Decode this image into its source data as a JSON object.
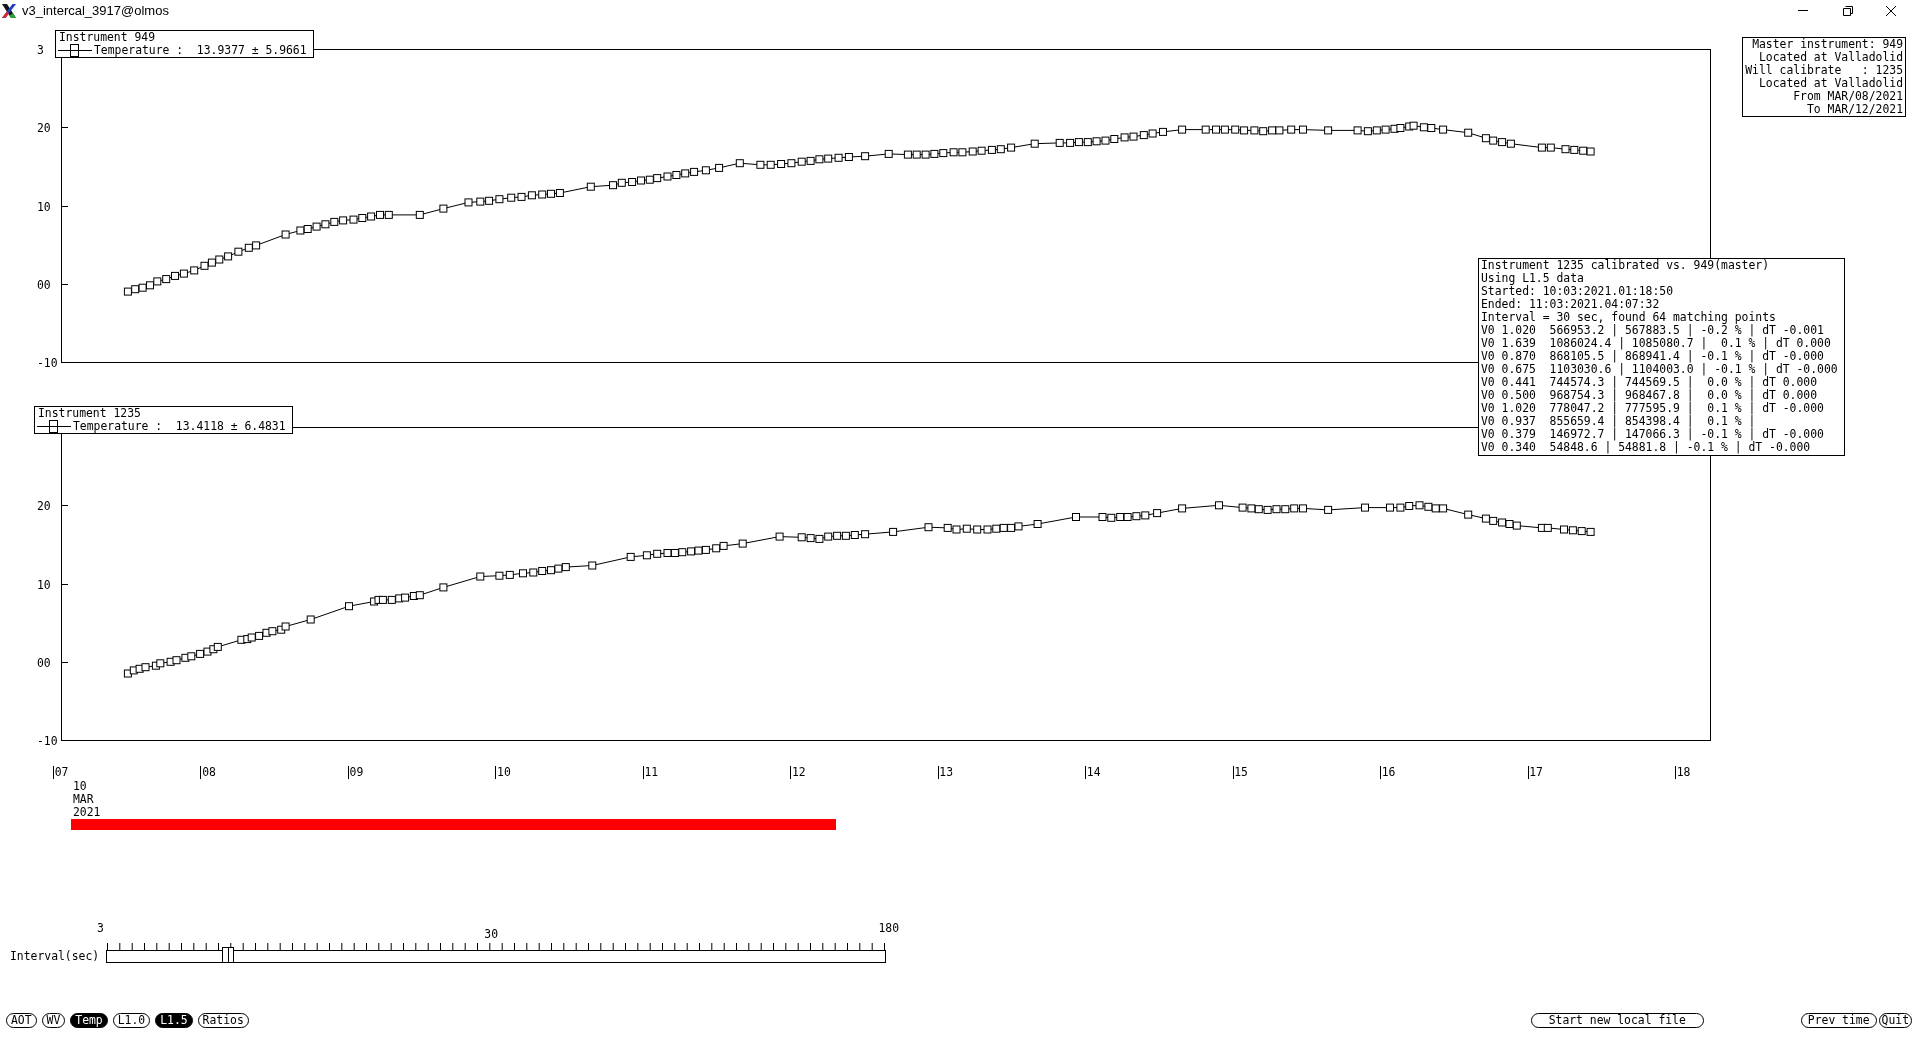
{
  "window": {
    "title": "v3_intercal_3917@olmos"
  },
  "charts": [
    {
      "partial_tick_label": "3",
      "chart_data": {
        "type": "line",
        "title": "Instrument 949",
        "xlim": [
          7.0,
          18.18
        ],
        "ylim": [
          -10,
          30
        ],
        "yticks": [
          {
            "value": 20,
            "label": "20"
          },
          {
            "value": 10,
            "label": "10"
          },
          {
            "value": 0,
            "label": "00"
          },
          {
            "value": -10,
            "label": "-10"
          }
        ],
        "x": [
          7.45,
          7.5,
          7.55,
          7.6,
          7.65,
          7.71,
          7.77,
          7.83,
          7.9,
          7.97,
          8.02,
          8.07,
          8.13,
          8.2,
          8.27,
          8.32,
          8.52,
          8.62,
          8.67,
          8.73,
          8.79,
          8.85,
          8.91,
          8.98,
          9.04,
          9.1,
          9.16,
          9.22,
          9.43,
          9.59,
          9.76,
          9.84,
          9.9,
          9.97,
          10.05,
          10.12,
          10.19,
          10.26,
          10.32,
          10.38,
          10.59,
          10.74,
          10.8,
          10.87,
          10.93,
          10.99,
          11.04,
          11.11,
          11.17,
          11.23,
          11.29,
          11.37,
          11.46,
          11.6,
          11.74,
          11.81,
          11.88,
          11.95,
          12.02,
          12.08,
          12.14,
          12.2,
          12.27,
          12.34,
          12.45,
          12.61,
          12.74,
          12.8,
          12.86,
          12.92,
          12.98,
          13.05,
          13.11,
          13.18,
          13.24,
          13.31,
          13.37,
          13.44,
          13.6,
          13.77,
          13.84,
          13.9,
          13.96,
          14.02,
          14.08,
          14.14,
          14.21,
          14.27,
          14.34,
          14.4,
          14.47,
          14.6,
          14.76,
          14.83,
          14.89,
          14.96,
          15.02,
          15.09,
          15.15,
          15.21,
          15.26,
          15.34,
          15.42,
          15.59,
          15.79,
          15.86,
          15.92,
          15.98,
          16.04,
          16.08,
          16.14,
          16.17,
          16.24,
          16.29,
          16.37,
          16.54,
          16.66,
          16.71,
          16.77,
          16.83,
          17.04,
          17.1,
          17.2,
          17.26,
          17.32,
          17.37
        ],
        "series": [
          {
            "name": "Temperature :  13.9377 ± 5.9661",
            "color": "#000000",
            "marker": "square",
            "values": [
              -1.0,
              -0.7,
              -0.5,
              -0.2,
              0.3,
              0.6,
              1.0,
              1.3,
              1.7,
              2.3,
              2.7,
              3.1,
              3.5,
              4.1,
              4.6,
              4.9,
              6.3,
              6.8,
              7.0,
              7.3,
              7.6,
              7.9,
              8.1,
              8.2,
              8.4,
              8.6,
              8.8,
              8.8,
              8.8,
              9.6,
              10.4,
              10.5,
              10.6,
              10.8,
              11.0,
              11.1,
              11.3,
              11.4,
              11.5,
              11.6,
              12.4,
              12.6,
              12.9,
              13.0,
              13.2,
              13.3,
              13.5,
              13.7,
              13.9,
              14.1,
              14.3,
              14.5,
              14.8,
              15.4,
              15.2,
              15.2,
              15.3,
              15.4,
              15.6,
              15.7,
              15.9,
              16.0,
              16.1,
              16.2,
              16.3,
              16.6,
              16.5,
              16.5,
              16.5,
              16.6,
              16.7,
              16.8,
              16.8,
              16.9,
              17.0,
              17.1,
              17.2,
              17.4,
              17.9,
              18.0,
              18.0,
              18.1,
              18.1,
              18.2,
              18.3,
              18.5,
              18.7,
              18.8,
              19.0,
              19.2,
              19.4,
              19.7,
              19.7,
              19.7,
              19.7,
              19.7,
              19.6,
              19.6,
              19.5,
              19.6,
              19.6,
              19.7,
              19.7,
              19.6,
              19.6,
              19.5,
              19.6,
              19.7,
              19.8,
              19.9,
              20.1,
              20.2,
              20.0,
              19.9,
              19.7,
              19.3,
              18.6,
              18.3,
              18.1,
              17.9,
              17.4,
              17.4,
              17.2,
              17.1,
              17.0,
              16.9
            ]
          }
        ]
      }
    },
    {
      "date_lines": [
        "10",
        "MAR",
        "2021"
      ],
      "chart_data": {
        "type": "line",
        "title": "Instrument 1235",
        "xlim": [
          7.0,
          18.18
        ],
        "ylim": [
          -10,
          30
        ],
        "yticks": [
          {
            "value": 20,
            "label": "20"
          },
          {
            "value": 10,
            "label": "10"
          },
          {
            "value": 0,
            "label": "00"
          },
          {
            "value": -10,
            "label": "-10"
          }
        ],
        "xticks": [
          {
            "value": 7,
            "label": "07"
          },
          {
            "value": 8,
            "label": "08"
          },
          {
            "value": 9,
            "label": "09"
          },
          {
            "value": 10,
            "label": "10"
          },
          {
            "value": 11,
            "label": "11"
          },
          {
            "value": 12,
            "label": "12"
          },
          {
            "value": 13,
            "label": "13"
          },
          {
            "value": 14,
            "label": "14"
          },
          {
            "value": 15,
            "label": "15"
          },
          {
            "value": 16,
            "label": "16"
          },
          {
            "value": 17,
            "label": "17"
          },
          {
            "value": 18,
            "label": "18"
          }
        ],
        "x": [
          7.45,
          7.49,
          7.53,
          7.57,
          7.64,
          7.67,
          7.74,
          7.78,
          7.84,
          7.88,
          7.94,
          7.99,
          8.03,
          8.06,
          8.22,
          8.26,
          8.29,
          8.34,
          8.39,
          8.43,
          8.49,
          8.52,
          8.69,
          8.95,
          9.12,
          9.15,
          9.18,
          9.24,
          9.29,
          9.33,
          9.39,
          9.43,
          9.59,
          9.84,
          9.97,
          10.04,
          10.13,
          10.2,
          10.26,
          10.32,
          10.37,
          10.42,
          10.6,
          10.86,
          10.97,
          11.04,
          11.11,
          11.16,
          11.21,
          11.27,
          11.32,
          11.37,
          11.44,
          11.49,
          11.62,
          11.87,
          12.02,
          12.08,
          12.14,
          12.2,
          12.26,
          12.32,
          12.38,
          12.45,
          12.64,
          12.88,
          13.01,
          13.07,
          13.14,
          13.21,
          13.28,
          13.34,
          13.39,
          13.44,
          13.49,
          13.62,
          13.88,
          14.06,
          14.12,
          14.18,
          14.23,
          14.29,
          14.35,
          14.43,
          14.6,
          14.85,
          15.01,
          15.07,
          15.12,
          15.18,
          15.24,
          15.3,
          15.36,
          15.42,
          15.59,
          15.84,
          16.01,
          16.08,
          16.14,
          16.21,
          16.27,
          16.32,
          16.37,
          16.54,
          16.66,
          16.71,
          16.77,
          16.82,
          16.87,
          17.04,
          17.08,
          17.19,
          17.25,
          17.31,
          17.37
        ],
        "series": [
          {
            "name": "Temperature :  13.4118 ± 6.4831",
            "color": "#000000",
            "marker": "square",
            "values": [
              -1.5,
              -1.1,
              -0.9,
              -0.7,
              -0.5,
              -0.2,
              0.0,
              0.2,
              0.5,
              0.7,
              1.0,
              1.3,
              1.6,
              1.9,
              2.8,
              2.9,
              3.1,
              3.3,
              3.7,
              3.9,
              4.1,
              4.5,
              5.4,
              7.1,
              7.7,
              7.9,
              7.9,
              7.9,
              8.1,
              8.2,
              8.4,
              8.5,
              9.5,
              10.9,
              11.0,
              11.1,
              11.3,
              11.4,
              11.6,
              11.7,
              11.9,
              12.1,
              12.3,
              13.4,
              13.6,
              13.8,
              13.9,
              13.9,
              14.0,
              14.1,
              14.2,
              14.3,
              14.5,
              14.8,
              15.1,
              16.0,
              15.9,
              15.8,
              15.7,
              16.0,
              16.1,
              16.1,
              16.2,
              16.3,
              16.6,
              17.2,
              17.1,
              16.9,
              17.0,
              16.9,
              16.9,
              17.0,
              17.1,
              17.1,
              17.3,
              17.6,
              18.5,
              18.5,
              18.4,
              18.5,
              18.5,
              18.6,
              18.7,
              19.0,
              19.6,
              20.0,
              19.7,
              19.6,
              19.5,
              19.4,
              19.5,
              19.5,
              19.6,
              19.6,
              19.4,
              19.7,
              19.7,
              19.7,
              19.9,
              20.0,
              19.8,
              19.6,
              19.6,
              18.8,
              18.3,
              18.0,
              17.8,
              17.6,
              17.4,
              17.1,
              17.1,
              16.9,
              16.8,
              16.7,
              16.6
            ]
          }
        ]
      }
    }
  ],
  "master_info": [
    "Master instrument: 949",
    "Located at Valladolid",
    "Will calibrate   : 1235",
    "Located at Valladolid",
    "From MAR/08/2021",
    "To MAR/12/2021"
  ],
  "calibration_report": [
    "Instrument 1235 calibrated vs. 949(master)",
    "Using L1.5 data",
    "Started: 10:03:2021.01:18:50",
    "Ended: 11:03:2021.04:07:32",
    "Interval = 30 sec, found 64 matching points",
    "V0 1.020  566953.2 | 567883.5 | -0.2 % | dT -0.001",
    "V0 1.639  1086024.4 | 1085080.7 |  0.1 % | dT 0.000",
    "V0 0.870  868105.5 | 868941.4 | -0.1 % | dT -0.000",
    "V0 0.675  1103030.6 | 1104003.0 | -0.1 % | dT -0.000",
    "V0 0.441  744574.3 | 744569.5 |  0.0 % | dT 0.000",
    "V0 0.500  968754.3 | 968467.8 |  0.0 % | dT 0.000",
    "V0 1.020  778047.2 | 777595.9 |  0.1 % | dT -0.000",
    "V0 0.937  855659.4 | 854398.4 |  0.1 % |",
    "V0 0.379  146972.7 | 147066.3 | -0.1 % | dT -0.000",
    "V0 0.340  54848.6 | 54881.8 | -0.1 % | dT -0.000"
  ],
  "interval_slider": {
    "label": "Interval(sec)",
    "scale_labels": [
      "3",
      "30",
      "180"
    ],
    "level": 0.156
  },
  "mode_buttons": [
    {
      "label": "AOT",
      "selected": false
    },
    {
      "label": "WV",
      "selected": false
    },
    {
      "label": "Temp",
      "selected": true
    },
    {
      "label": "L1.0",
      "selected": false
    },
    {
      "label": "L1.5",
      "selected": true
    },
    {
      "label": "Ratios",
      "selected": false
    }
  ],
  "file_button": "Start new local file",
  "nav_buttons": [
    "Prev time",
    "Quit"
  ]
}
